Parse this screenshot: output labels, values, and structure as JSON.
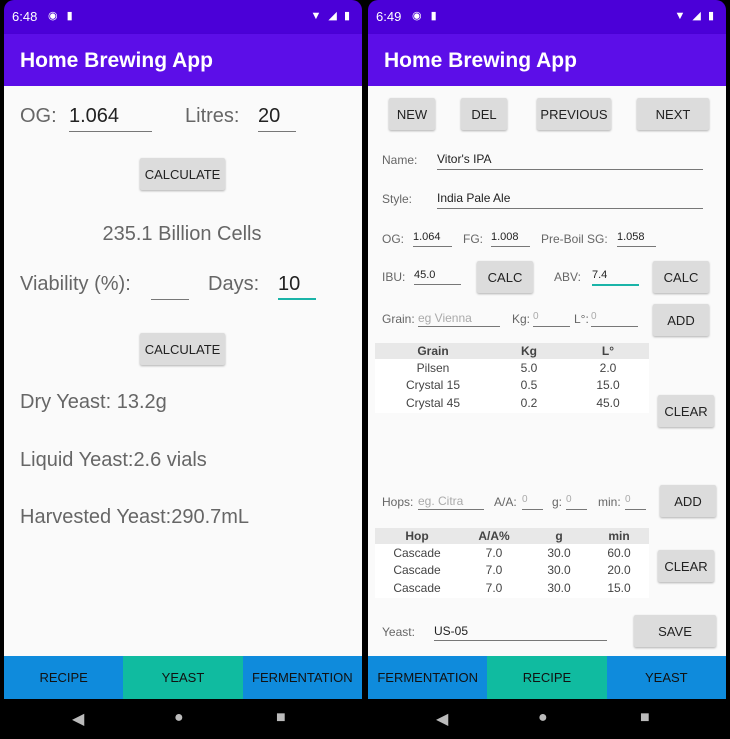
{
  "left": {
    "status": {
      "time": "6:48"
    },
    "app_title": "Home Brewing App",
    "og_label": "OG:",
    "og_value": "1.064",
    "litres_label": "Litres:",
    "litres_value": "20",
    "calculate_label": "CALCULATE",
    "cells_result": "235.1 Billion Cells",
    "viability_label": "Viability (%):",
    "viability_value": "",
    "days_label": "Days:",
    "days_value": "10",
    "calculate2_label": "CALCULATE",
    "dry_yeast": "Dry Yeast: 13.2g",
    "liquid_yeast": "Liquid Yeast:2.6 vials",
    "harvested_yeast": "Harvested Yeast:290.7mL",
    "nav": [
      "RECIPE",
      "YEAST",
      "FERMENTATION"
    ]
  },
  "right": {
    "status": {
      "time": "6:49"
    },
    "app_title": "Home Brewing App",
    "buttons": {
      "new": "NEW",
      "del": "DEL",
      "previous": "PREVIOUS",
      "next": "NEXT"
    },
    "name_label": "Name:",
    "name_value": "Vitor's IPA",
    "style_label": "Style:",
    "style_value": "India Pale Ale",
    "og_label": "OG:",
    "og_value": "1.064",
    "fg_label": "FG:",
    "fg_value": "1.008",
    "preboil_label": "Pre-Boil SG:",
    "preboil_value": "1.058",
    "ibu_label": "IBU:",
    "ibu_value": "45.0",
    "calc_label": "CALC",
    "abv_label": "ABV:",
    "abv_value": "7.4",
    "calc2_label": "CALC",
    "grain_label": "Grain:",
    "grain_placeholder": "eg Vienna",
    "kg_label": "Kg:",
    "kg_placeholder": "0",
    "lovibond_label": "L°:",
    "lovibond_placeholder": "0",
    "add_label": "ADD",
    "grain_table": {
      "headers": [
        "Grain",
        "Kg",
        "L°"
      ],
      "rows": [
        [
          "Pilsen",
          "5.0",
          "2.0"
        ],
        [
          "Crystal 15",
          "0.5",
          "15.0"
        ],
        [
          "Crystal 45",
          "0.2",
          "45.0"
        ]
      ]
    },
    "clear_label": "CLEAR",
    "hops_label": "Hops:",
    "hops_placeholder": "eg. Citra",
    "aa_label": "A/A:",
    "aa_placeholder": "0",
    "g_label": "g:",
    "g_placeholder": "0",
    "min_label": "min:",
    "min_placeholder": "0",
    "add2_label": "ADD",
    "hop_table": {
      "headers": [
        "Hop",
        "A/A%",
        "g",
        "min"
      ],
      "rows": [
        [
          "Cascade",
          "7.0",
          "30.0",
          "60.0"
        ],
        [
          "Cascade",
          "7.0",
          "30.0",
          "20.0"
        ],
        [
          "Cascade",
          "7.0",
          "30.0",
          "15.0"
        ]
      ]
    },
    "clear2_label": "CLEAR",
    "yeast_label": "Yeast:",
    "yeast_value": "US-05",
    "save_label": "SAVE",
    "nav": [
      "FERMENTATION",
      "RECIPE",
      "YEAST"
    ]
  },
  "colors": {
    "status_bar": "#4b00d8",
    "app_bar": "#5c0ee8",
    "nav_blue": "#0f8bdc",
    "nav_teal": "#10bba0",
    "focus_underline": "#1ab4a8"
  },
  "icons": {
    "status": [
      "wifi-icon",
      "signal-icon",
      "battery-icon"
    ],
    "system_nav": [
      "back-icon",
      "home-icon",
      "recents-icon"
    ]
  }
}
